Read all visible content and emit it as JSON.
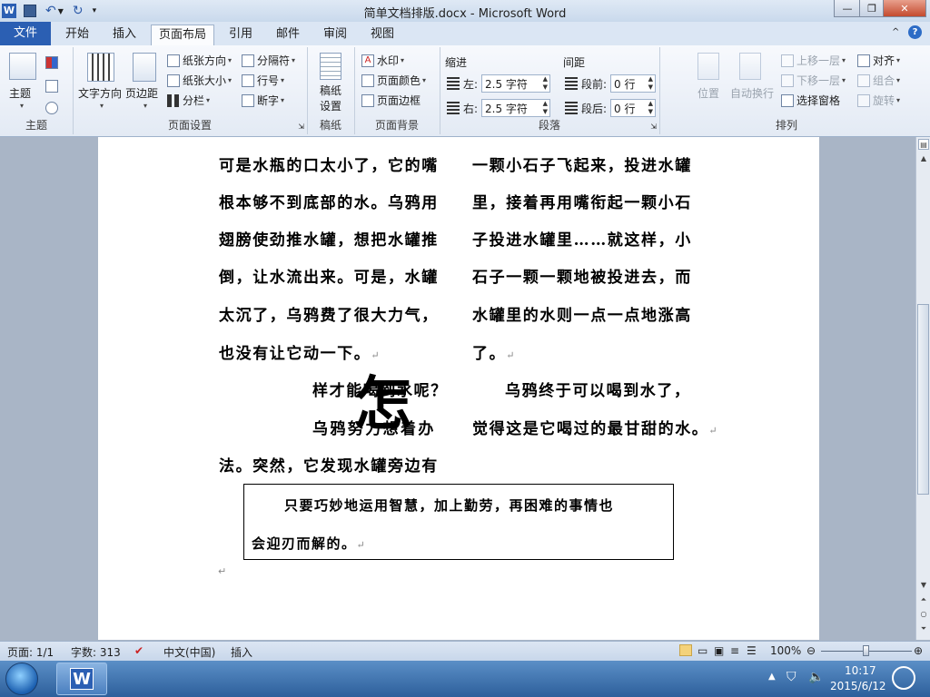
{
  "window": {
    "title": "简单文档排版.docx - Microsoft Word"
  },
  "tabs": [
    {
      "label": "文件"
    },
    {
      "label": "开始"
    },
    {
      "label": "插入"
    },
    {
      "label": "页面布局"
    },
    {
      "label": "引用"
    },
    {
      "label": "邮件"
    },
    {
      "label": "审阅"
    },
    {
      "label": "视图"
    }
  ],
  "ribbon": {
    "theme": {
      "button": "主题",
      "group": "主题"
    },
    "page_setup": {
      "text_direction": "文字方向",
      "margins": "页边距",
      "orientation": "纸张方向",
      "size": "纸张大小",
      "columns": "分栏",
      "breaks": "分隔符",
      "line_numbers": "行号",
      "hyphenation": "断字",
      "group": "页面设置"
    },
    "manuscript": {
      "button": "稿纸\n设置",
      "group": "稿纸"
    },
    "page_background": {
      "watermark": "水印",
      "page_color": "页面颜色",
      "page_borders": "页面边框",
      "group": "页面背景"
    },
    "paragraph": {
      "indent_title": "缩进",
      "left_label": "左:",
      "left_value": "2.5 字符",
      "right_label": "右:",
      "right_value": "2.5 字符",
      "spacing_title": "间距",
      "before_label": "段前:",
      "before_value": "0 行",
      "after_label": "段后:",
      "after_value": "0 行",
      "group": "段落"
    },
    "arrange": {
      "position": "位置",
      "wrap_text": "自动换行",
      "bring_forward": "上移一层",
      "send_backward": "下移一层",
      "selection_pane": "选择窗格",
      "align": "对齐",
      "group_btn": "组合",
      "rotate": "旋转",
      "group": "排列"
    }
  },
  "document": {
    "lines": [
      "可是水瓶的口太小了，它的嘴",
      "根本够不到底部的水。乌鸦用",
      "翅膀使劲推水罐，想把水罐推",
      "倒，让水流出来。可是，水罐",
      "太沉了，乌鸦费了很大力气，",
      "也没有让它动一下。",
      "一颗小石子飞起来，投进水罐",
      "里，接着再用嘴衔起一颗小石",
      "子投进水罐里……就这样，小",
      "石子一颗一颗地被投进去，而",
      "水罐里的水则一点一点地涨高",
      "了。",
      "样才能喝到水呢？",
      "乌鸦努力想着办",
      "法。突然，它发现水罐旁边有",
      "乌鸦终于可以喝到水了，",
      "觉得这是它喝过的最甘甜的水。"
    ],
    "dropcap": "怎",
    "textbox_lines": [
      "只要巧妙地运用智慧，加上勤劳，再困难的事情也",
      "会迎刃而解的。"
    ],
    "para_mark": "↵"
  },
  "status": {
    "page": "页面: 1/1",
    "words": "字数: 313",
    "language": "中文(中国)",
    "mode": "插入",
    "zoom": "100%"
  },
  "taskbar": {
    "time": "10:17",
    "date": "2015/6/12"
  },
  "colors": {
    "file_tab": "#2b5fb3",
    "ribbon_bg": "#e3eaf4",
    "taskbar": "#2d5f9b"
  }
}
